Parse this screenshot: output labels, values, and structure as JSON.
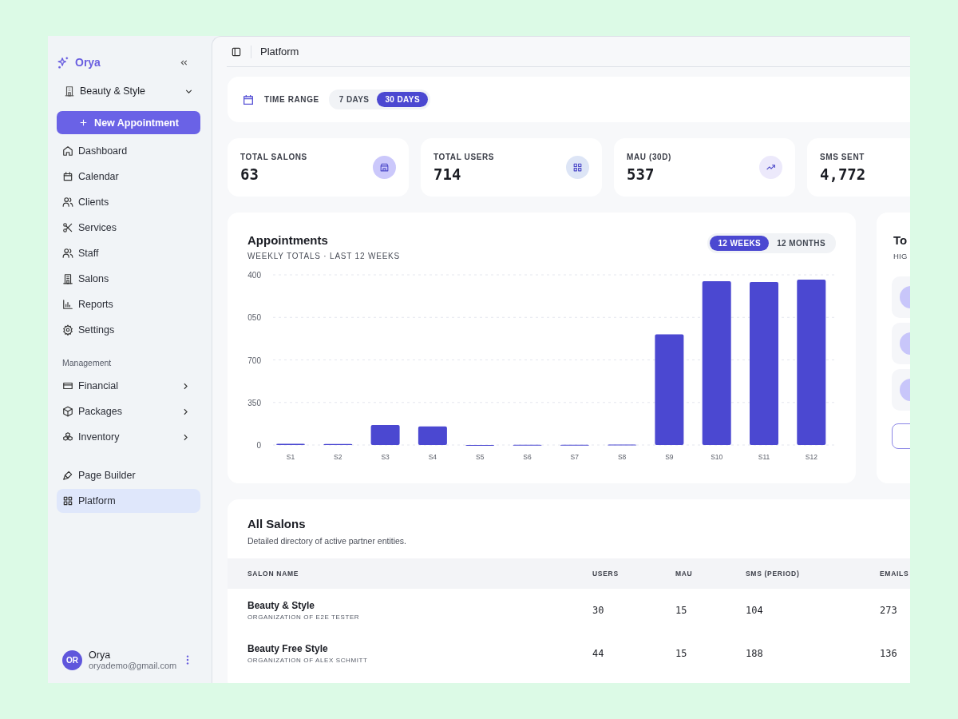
{
  "sidebar": {
    "brand": "Orya",
    "workspace": "Beauty & Style",
    "new_button": "New Appointment",
    "main_items": [
      {
        "label": "Dashboard",
        "selected": false,
        "expandable": false
      },
      {
        "label": "Calendar",
        "selected": false,
        "expandable": false
      },
      {
        "label": "Clients",
        "selected": false,
        "expandable": false
      },
      {
        "label": "Services",
        "selected": false,
        "expandable": false
      },
      {
        "label": "Staff",
        "selected": false,
        "expandable": false
      },
      {
        "label": "Salons",
        "selected": false,
        "expandable": false
      },
      {
        "label": "Reports",
        "selected": false,
        "expandable": false
      },
      {
        "label": "Settings",
        "selected": false,
        "expandable": false
      }
    ],
    "management_heading": "Management",
    "management_items": [
      {
        "label": "Financial",
        "selected": false,
        "expandable": true
      },
      {
        "label": "Packages",
        "selected": false,
        "expandable": true
      },
      {
        "label": "Inventory",
        "selected": false,
        "expandable": true
      }
    ],
    "tool_items": [
      {
        "label": "Page Builder",
        "selected": false,
        "expandable": false
      },
      {
        "label": "Platform",
        "selected": true,
        "expandable": false
      }
    ],
    "user": {
      "initials": "OR",
      "name": "Orya",
      "email": "oryademo@gmail.com"
    }
  },
  "header": {
    "title": "Platform"
  },
  "time_range": {
    "label": "TIME RANGE",
    "options": [
      {
        "label": "7 DAYS",
        "selected": false
      },
      {
        "label": "30 DAYS",
        "selected": true
      }
    ]
  },
  "stats": [
    {
      "label": "TOTAL SALONS",
      "value": "63"
    },
    {
      "label": "TOTAL USERS",
      "value": "714"
    },
    {
      "label": "MAU (30D)",
      "value": "537"
    },
    {
      "label": "SMS SENT",
      "value": "4,772"
    }
  ],
  "appointments": {
    "title": "Appointments",
    "subtitle": "WEEKLY TOTALS · LAST 12 WEEKS",
    "options": [
      {
        "label": "12 WEEKS",
        "selected": true
      },
      {
        "label": "12 MONTHS",
        "selected": false
      }
    ],
    "chart_data": {
      "type": "bar",
      "categories": [
        "S1",
        "S2",
        "S3",
        "S4",
        "S5",
        "S6",
        "S7",
        "S8",
        "S9",
        "S10",
        "S11",
        "S12"
      ],
      "series": [
        {
          "color": "#4b48d1",
          "values": [
            10,
            8,
            165,
            152,
            0,
            2,
            2,
            3,
            911,
            1347,
            1341,
            1360
          ]
        }
      ],
      "ylim": [
        0,
        1400
      ],
      "yticks": [
        0,
        350,
        700
      ],
      "grid": true
    },
    "cut_axis_labels": [
      "400",
      "050"
    ]
  },
  "side_card": {
    "title": "To",
    "subtitle": "HIG"
  },
  "salons": {
    "title": "All Salons",
    "description": "Detailed directory of active partner entities.",
    "columns": [
      "SALON NAME",
      "USERS",
      "MAU",
      "SMS (PERIOD)",
      "EMAILS"
    ],
    "rows": [
      {
        "name": "Beauty & Style",
        "org": "ORGANIZATION OF E2E TESTER",
        "users": "30",
        "mau": "15",
        "sms": "104",
        "emails": "273"
      },
      {
        "name": "Beauty Free Style",
        "org": "ORGANIZATION OF ALEX SCHMITT",
        "users": "44",
        "mau": "15",
        "sms": "188",
        "emails": "136"
      }
    ]
  }
}
